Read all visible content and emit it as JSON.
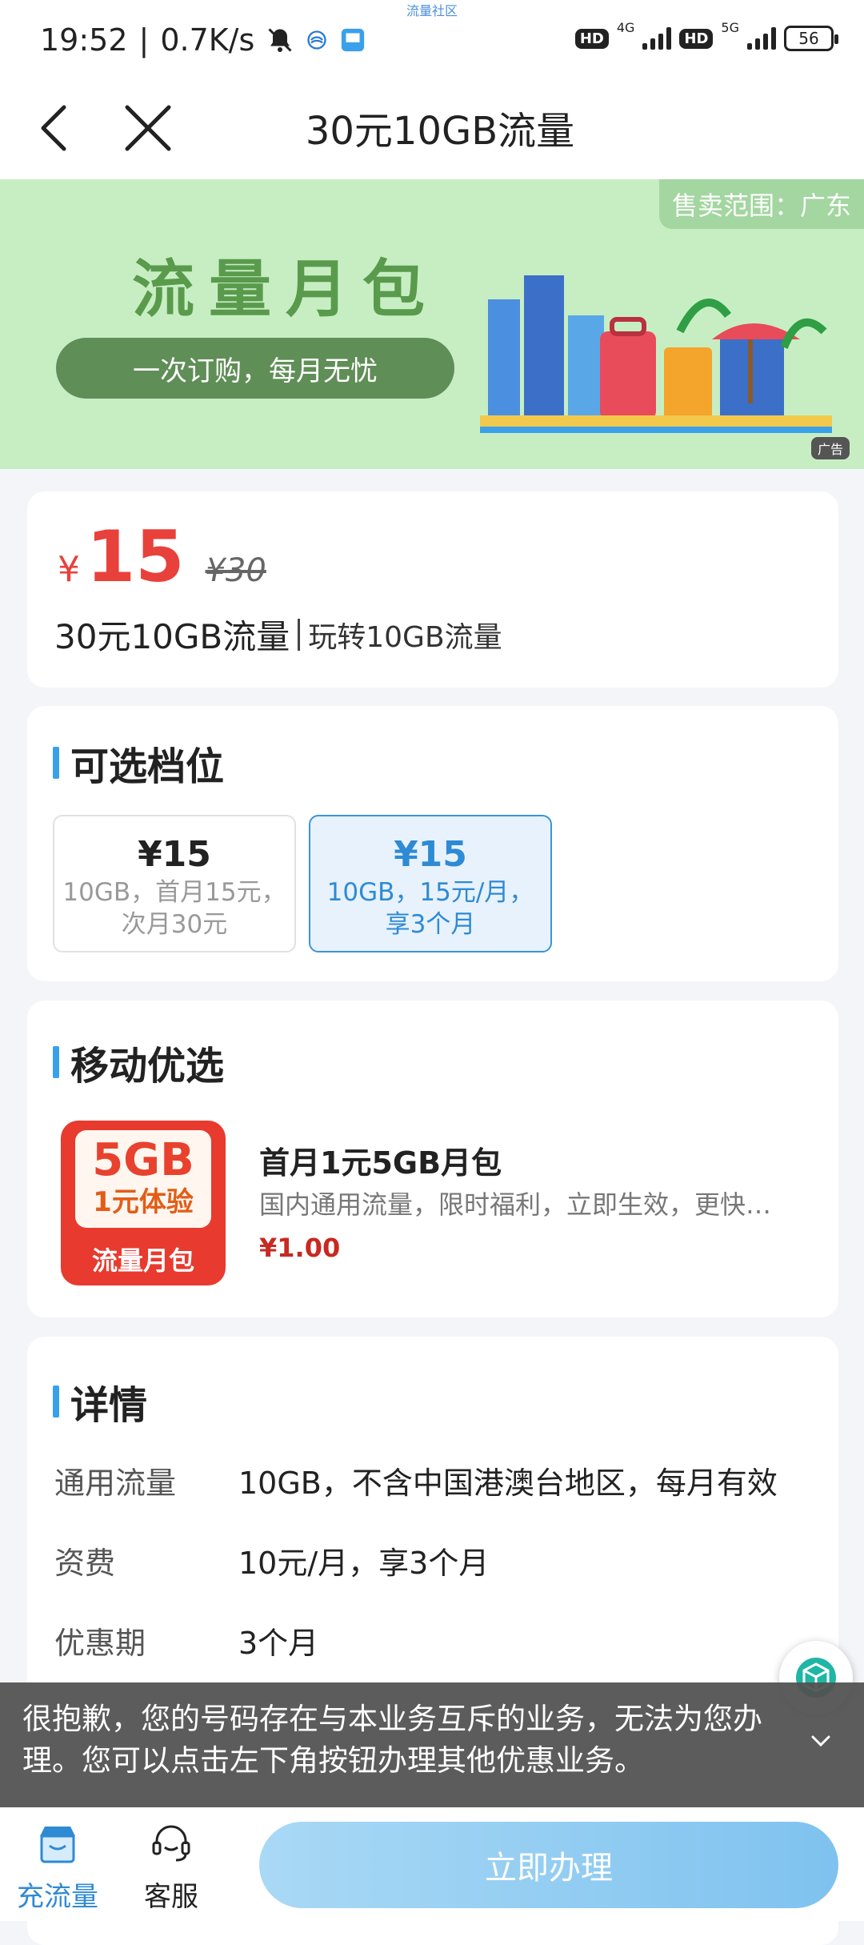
{
  "status_bar": {
    "time": "19:52",
    "speed": "0.7K/s",
    "top_text": "流量社区",
    "hd1": "HD",
    "net1": "4G",
    "hd2": "HD",
    "net2": "5G",
    "battery": "56"
  },
  "nav": {
    "title": "30元10GB流量"
  },
  "banner": {
    "region": "售卖范围：广东",
    "title": "流量月包",
    "slogan": "一次订购，每月无忧",
    "ad": "广告"
  },
  "price_card": {
    "currency": "¥",
    "price": "15",
    "original_price": "¥30",
    "name": "30元10GB流量",
    "subtitle": "玩转10GB流量"
  },
  "tiers": {
    "title": "可选档位",
    "items": [
      {
        "price": "¥15",
        "desc": "10GB，首月15元，次月30元",
        "selected": false
      },
      {
        "price": "¥15",
        "desc": "10GB，15元/月，享3个月",
        "selected": true
      }
    ]
  },
  "picks": {
    "title": "移动优选",
    "item": {
      "img_big": "5GB",
      "img_mid": "1元体验",
      "img_bottom": "流量月包",
      "name": "首月1元5GB月包",
      "desc": "国内通用流量，限时福利，立即生效，更快…",
      "price": "¥1.00"
    }
  },
  "details": {
    "title": "详情",
    "rows": [
      {
        "label": "通用流量",
        "value": "10GB，不含中国港澳台地区，每月有效"
      },
      {
        "label": "资费",
        "value": "10元/月，享3个月"
      },
      {
        "label": "优惠期",
        "value": "3个月"
      }
    ]
  },
  "toast": {
    "message": "很抱歉，您的号码存在与本业务互斥的业务，无法为您办理。您可以点击左下角按钮办理其他优惠业务。"
  },
  "bottom_bar": {
    "tab_flow": "充流量",
    "tab_service": "客服",
    "apply": "立即办理"
  },
  "colors": {
    "accent": "#2f8ad4",
    "price_red": "#e8413b",
    "banner_green": "#c7eec3"
  }
}
